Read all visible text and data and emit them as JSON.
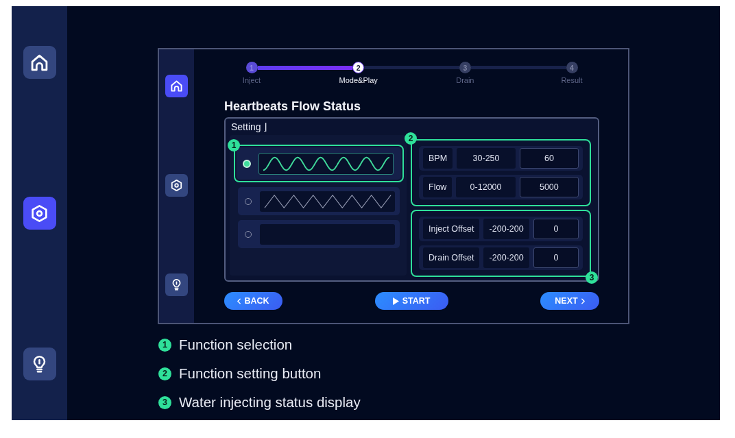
{
  "sidebar": {
    "items": [
      {
        "kind": "home",
        "selected": false
      },
      {
        "kind": "settings",
        "selected": true
      },
      {
        "kind": "tips",
        "selected": false
      }
    ]
  },
  "screen": {
    "sidebar": {
      "items": [
        {
          "kind": "home",
          "selected": true
        },
        {
          "kind": "settings",
          "selected": false
        },
        {
          "kind": "tips",
          "selected": false
        }
      ]
    },
    "stepper": {
      "steps": [
        {
          "number": "1",
          "label": "Inject",
          "completed": true,
          "selected": false
        },
        {
          "number": "2",
          "label": "Mode&Play",
          "completed": false,
          "selected": true
        },
        {
          "number": "3",
          "label": "Drain",
          "completed": false,
          "selected": false
        },
        {
          "number": "4",
          "label": "Result",
          "completed": false,
          "selected": false
        }
      ]
    },
    "title": "Heartbeats Flow Status",
    "setting_panel": {
      "title": "Setting ⌋",
      "waveforms": {
        "callout": "1",
        "options": [
          {
            "kind": "sine",
            "selected": true
          },
          {
            "kind": "triangle",
            "selected": false
          },
          {
            "kind": "blank",
            "selected": false
          }
        ]
      },
      "groups": [
        {
          "callout": "2",
          "rows": [
            {
              "label": "BPM",
              "range": "30-250",
              "value": "60"
            },
            {
              "label": "Flow",
              "range": "0-12000",
              "value": "5000"
            }
          ]
        },
        {
          "callout": "3",
          "rows": [
            {
              "label": "Inject Offset",
              "range": "-200-200",
              "value": "0"
            },
            {
              "label": "Drain Offset",
              "range": "-200-200",
              "value": "0"
            }
          ]
        }
      ]
    },
    "buttons": [
      {
        "kind": "back",
        "label": "BACK"
      },
      {
        "kind": "start",
        "label": "START"
      },
      {
        "kind": "next",
        "label": "NEXT"
      }
    ]
  },
  "legend": [
    {
      "number": "1",
      "text": "Function selection"
    },
    {
      "number": "2",
      "text": "Function setting button"
    },
    {
      "number": "3",
      "text": "Water injecting status display"
    }
  ]
}
